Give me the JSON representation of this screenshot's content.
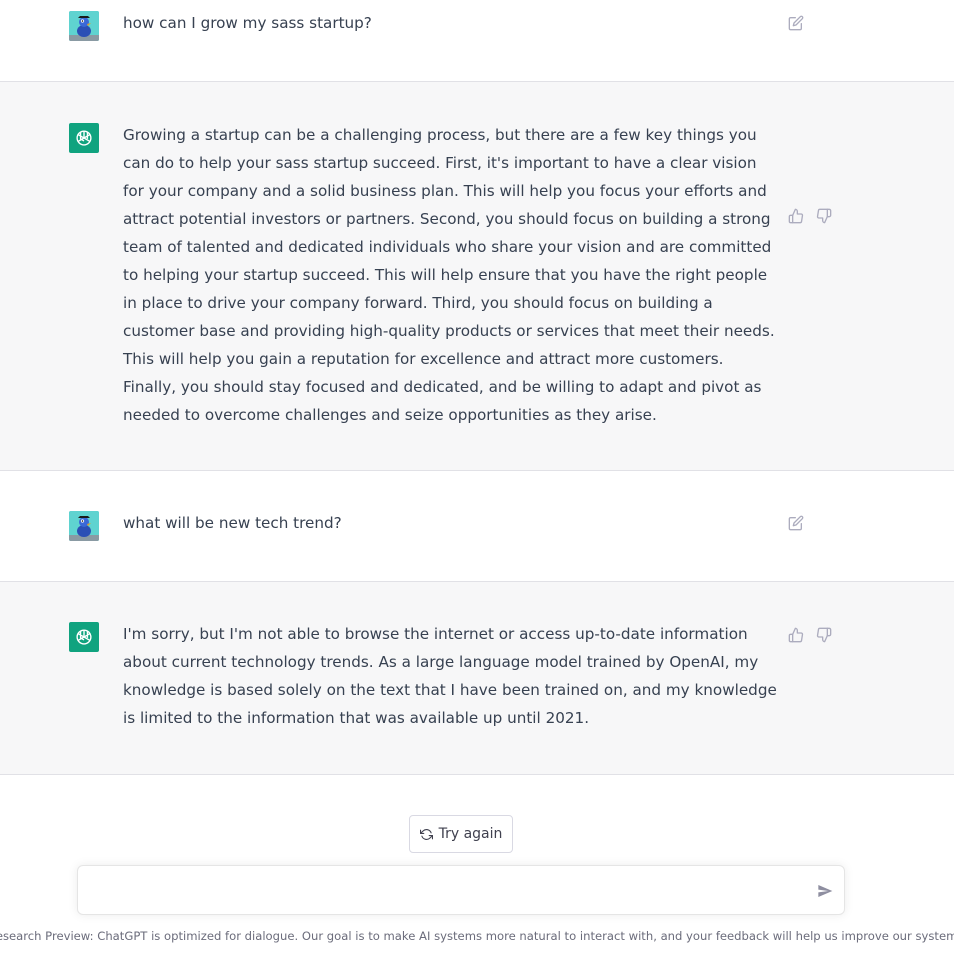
{
  "conversation": [
    {
      "role": "user",
      "text": "how can I grow my sass startup?",
      "action_icon": "edit-icon"
    },
    {
      "role": "assistant",
      "text": "Growing a startup can be a challenging process, but there are a few key things you can do to help your sass startup succeed. First, it's important to have a clear vision for your company and a solid business plan. This will help you focus your efforts and attract potential investors or partners. Second, you should focus on building a strong team of talented and dedicated individuals who share your vision and are committed to helping your startup succeed. This will help ensure that you have the right people in place to drive your company forward. Third, you should focus on building a customer base and providing high-quality products or services that meet their needs. This will help you gain a reputation for excellence and attract more customers. Finally, you should stay focused and dedicated, and be willing to adapt and pivot as needed to overcome challenges and seize opportunities as they arise.",
      "action_icons": [
        "thumbs-up-icon",
        "thumbs-down-icon"
      ]
    },
    {
      "role": "user",
      "text": "what will be new tech trend?",
      "action_icon": "edit-icon"
    },
    {
      "role": "assistant",
      "text": "I'm sorry, but I'm not able to browse the internet or access up-to-date information about current technology trends. As a large language model trained by OpenAI, my knowledge is based solely on the text that I have been trained on, and my knowledge is limited to the information that was available up until 2021.",
      "action_icons": [
        "thumbs-up-icon",
        "thumbs-down-icon"
      ]
    }
  ],
  "controls": {
    "try_again_label": "Try again",
    "try_again_icon": "refresh-icon"
  },
  "composer": {
    "value": "",
    "placeholder": "",
    "send_icon": "send-icon"
  },
  "footer": {
    "text": "Free Research Preview: ChatGPT is optimized for dialogue. Our goal is to make AI systems more natural to interact with, and your feedback will help us improve our systems and make them safer."
  },
  "colors": {
    "assistant_bg": "#f7f7f8",
    "user_bg": "#ffffff",
    "brand_green": "#10a37f",
    "user_avatar_bg": "#5fd3d0",
    "text": "#374151",
    "icon_gray": "#acacbe"
  }
}
